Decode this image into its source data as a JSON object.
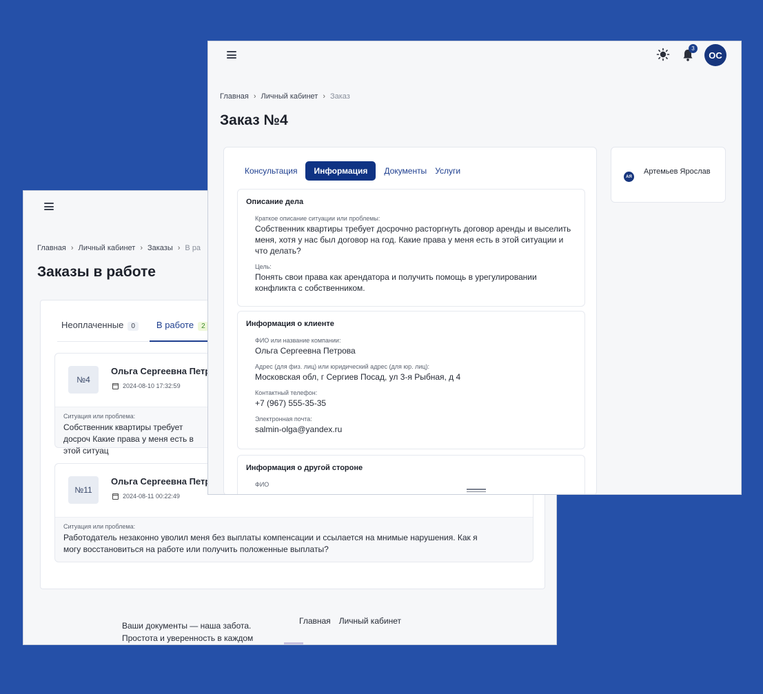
{
  "back": {
    "breadcrumb": [
      "Главная",
      "Личный кабинет",
      "Заказы",
      "В ра"
    ],
    "title": "Заказы в работе",
    "tabs": [
      {
        "label": "Неоплаченные",
        "count": "0"
      },
      {
        "label": "В работе",
        "count": "2"
      }
    ],
    "orders": [
      {
        "num": "№4",
        "name": "Ольга Сергеевна Петр",
        "date": "2024-08-10 17:32:59",
        "problem_label": "Ситуация или проблема:",
        "problem": "Собственник квартиры требует досроч Какие права у меня есть в этой ситуац"
      },
      {
        "num": "№11",
        "name": "Ольга Сергеевна Петр",
        "date": "2024-08-11 00:22:49",
        "problem_label": "Ситуация или проблема:",
        "problem": "Работодатель незаконно уволил меня без выплаты компенсации и ссылается на мнимые нарушения. Как я могу восстановиться на работе или получить положенные выплаты?"
      }
    ],
    "footer": {
      "text": "Ваши документы — наша забота. Простота и уверенность в каждом заявлении!",
      "links": [
        "Главная",
        "Личный кабинет"
      ]
    }
  },
  "front": {
    "header": {
      "theme_icon": "sun-icon",
      "bell_icon": "bell-icon",
      "notifications": "3",
      "avatar": "ОС"
    },
    "breadcrumb": [
      "Главная",
      "Личный кабинет",
      "Заказ"
    ],
    "title": "Заказ №4",
    "tabs": [
      "Консультация",
      "Информация",
      "Документы",
      "Услуги"
    ],
    "active_tab": "Информация",
    "case": {
      "title": "Описание дела",
      "short_label": "Краткое описание ситуации или проблемы:",
      "short_text": "Собственник квартиры требует досрочно расторгнуть договор аренды и выселить меня, хотя у нас был договор на год. Какие права у меня есть в этой ситуации и что делать?",
      "goal_label": "Цель:",
      "goal_text": "Понять свои права как арендатора и получить помощь в урегулировании конфликта с собственником."
    },
    "client": {
      "title": "Информация о клиенте",
      "name_label": "ФИО или название компании:",
      "name": "Ольга Сергеевна Петрова",
      "address_label": "Адрес (для физ. лиц) или юридический адрес (для юр. лиц):",
      "address": "Московская обл, г Сергиев Посад, ул 3-я Рыбная, д 4",
      "phone_label": "Контактный телефон:",
      "phone": "+7 (967) 555-35-35",
      "email_label": "Электронная почта:",
      "email": "salmin-olga@yandex.ru"
    },
    "other": {
      "title": "Информация о другой стороне",
      "partial_label": "ФИО"
    },
    "specialist": {
      "initials": "АЯ",
      "name": "Артемьев Ярослав"
    }
  },
  "colors": {
    "background": "#2550a8",
    "accent": "#0f3384",
    "avatar": "#17367e"
  }
}
